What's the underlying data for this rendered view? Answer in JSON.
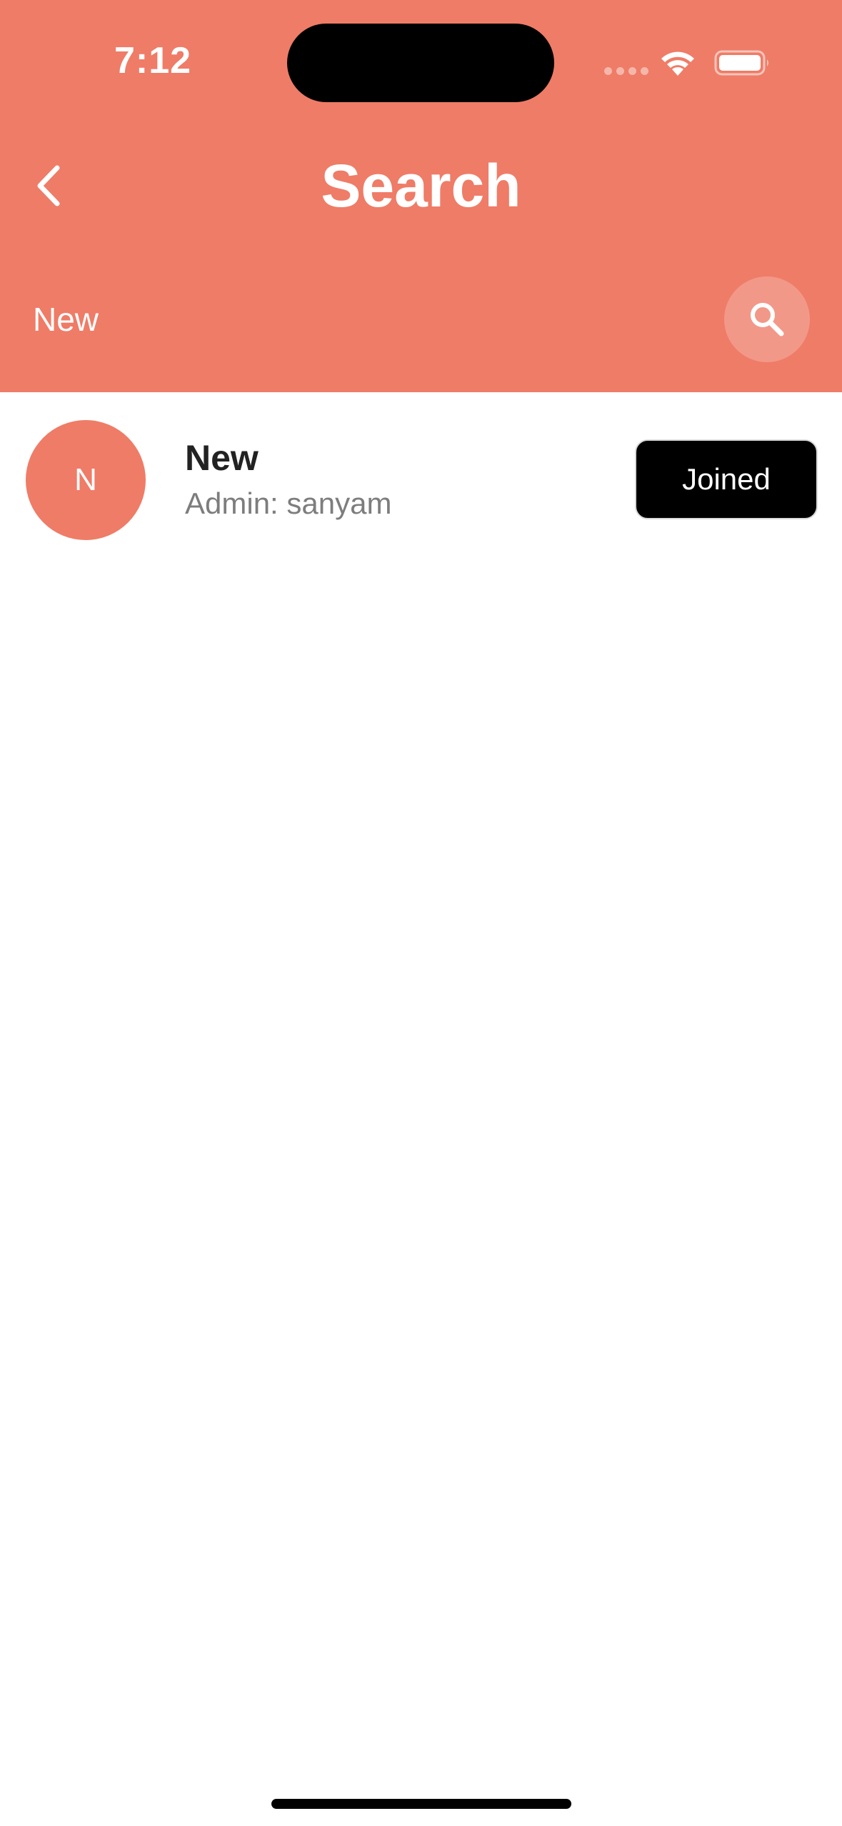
{
  "status_bar": {
    "time": "7:12"
  },
  "header": {
    "title": "Search",
    "background_color": "#ef7c67"
  },
  "search": {
    "value": "New",
    "button_icon": "search-icon"
  },
  "results": [
    {
      "avatar_letter": "N",
      "name": "New",
      "subtitle": "Admin: sanyam",
      "action_label": "Joined"
    }
  ]
}
